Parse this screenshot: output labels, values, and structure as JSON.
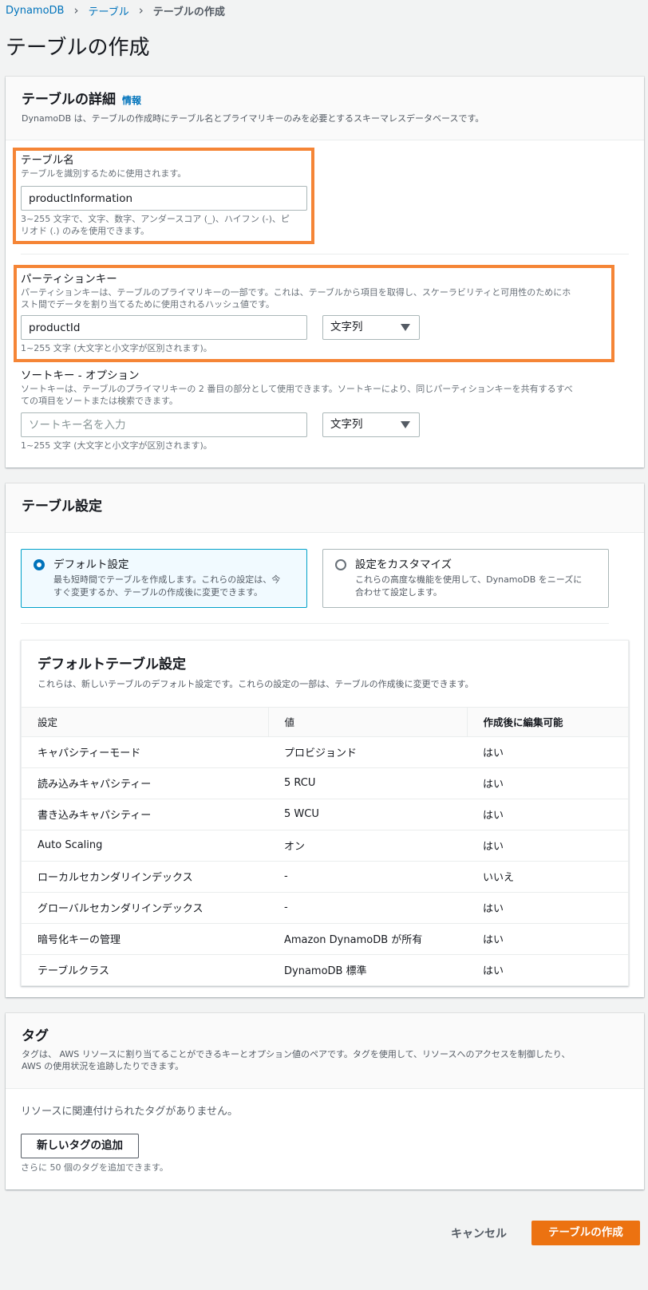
{
  "breadcrumb": {
    "items": [
      "DynamoDB",
      "テーブル"
    ],
    "current": "テーブルの作成"
  },
  "page_title": "テーブルの作成",
  "details": {
    "title": "テーブルの詳細",
    "info": "情報",
    "description": "DynamoDB は、テーブルの作成時にテーブル名とプライマリキーのみを必要とするスキーマレスデータベースです。",
    "table_name": {
      "label": "テーブル名",
      "description": "テーブルを識別するために使用されます。",
      "value": "productInformation",
      "hint_line1": "3~255 文字で、文字、数字、アンダースコア (_)、ハイフン (-)、ピ",
      "hint_line2": "リオド (.) のみを使用できます。"
    },
    "partition_key": {
      "label": "パーティションキー",
      "description_line1": "パーティションキーは、テーブルのプライマリキーの一部です。これは、テーブルから項目を取得し、スケーラビリティと可用性のためにホ",
      "description_line2": "スト間でデータを割り当てるために使用されるハッシュ値です。",
      "value": "productId",
      "type": "文字列",
      "hint": "1~255 文字 (大文字と小文字が区別されます)。"
    },
    "sort_key": {
      "label": "ソートキー - オプション",
      "description_line1": "ソートキーは、テーブルのプライマリキーの 2 番目の部分として使用できます。ソートキーにより、同じパーティションキーを共有するすべ",
      "description_line2": "ての項目をソートまたは検索できます。",
      "placeholder": "ソートキー名を入力",
      "type": "文字列",
      "hint": "1~255 文字 (大文字と小文字が区別されます)。"
    }
  },
  "settings": {
    "title": "テーブル設定",
    "default_option": {
      "title": "デフォルト設定",
      "desc_line1": "最も短時間でテーブルを作成します。これらの設定は、今",
      "desc_line2": "すぐ変更するか、テーブルの作成後に変更できます。"
    },
    "custom_option": {
      "title": "設定をカスタマイズ",
      "desc_line1": "これらの高度な機能を使用して、DynamoDB をニーズに",
      "desc_line2": "合わせて設定します。"
    },
    "default_table": {
      "title": "デフォルトテーブル設定",
      "description": "これらは、新しいテーブルのデフォルト設定です。これらの設定の一部は、テーブルの作成後に変更できます。",
      "columns": [
        "設定",
        "値",
        "作成後に編集可能"
      ],
      "rows": [
        [
          "キャパシティーモード",
          "プロビジョンド",
          "はい"
        ],
        [
          "読み込みキャパシティー",
          "5 RCU",
          "はい"
        ],
        [
          "書き込みキャパシティー",
          "5 WCU",
          "はい"
        ],
        [
          "Auto Scaling",
          "オン",
          "はい"
        ],
        [
          "ローカルセカンダリインデックス",
          "-",
          "いいえ"
        ],
        [
          "グローバルセカンダリインデックス",
          "-",
          "はい"
        ],
        [
          "暗号化キーの管理",
          "Amazon DynamoDB が所有",
          "はい"
        ],
        [
          "テーブルクラス",
          "DynamoDB 標準",
          "はい"
        ]
      ]
    }
  },
  "tags": {
    "title": "タグ",
    "desc_line1": "タグは、 AWS リソースに割り当てることができるキーとオプション値のペアです。タグを使用して、リソースへのアクセスを制御したり、",
    "desc_line2": "AWS の使用状況を追跡したりできます。",
    "empty": "リソースに関連付けられたタグがありません。",
    "add_button": "新しいタグの追加",
    "limit_hint": "さらに 50 個のタグを追加できます。"
  },
  "footer": {
    "cancel": "キャンセル",
    "create": "テーブルの作成"
  },
  "colors": {
    "accent_orange": "#ec7211",
    "highlight_orange": "#f58536",
    "link_blue": "#0073bb",
    "selected_border": "#00a1c9"
  }
}
